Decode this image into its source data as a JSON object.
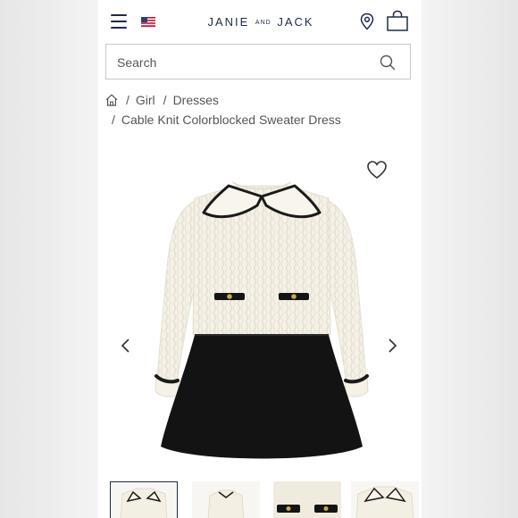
{
  "header": {
    "brand_left": "JANIE",
    "brand_and": "AND",
    "brand_right": "JACK",
    "menu_icon": "hamburger-menu-icon",
    "flag_icon": "us-flag-icon",
    "location_icon": "location-pin-icon",
    "bag_icon": "shopping-bag-icon"
  },
  "search": {
    "placeholder": "Search",
    "icon": "search-icon"
  },
  "breadcrumb": {
    "home_icon": "home-icon",
    "separator": "/",
    "items": [
      "Girl",
      "Dresses",
      "Cable Knit Colorblocked Sweater Dress"
    ]
  },
  "gallery": {
    "favorite_icon": "heart-icon",
    "prev_icon": "chevron-left-icon",
    "next_icon": "chevron-right-icon",
    "thumbnail_count": 4,
    "active_thumbnail": 1
  },
  "colors": {
    "brand_navy": "#1d2b4a",
    "sweater_cream": "#f5f1e6",
    "skirt_black": "#121212"
  }
}
